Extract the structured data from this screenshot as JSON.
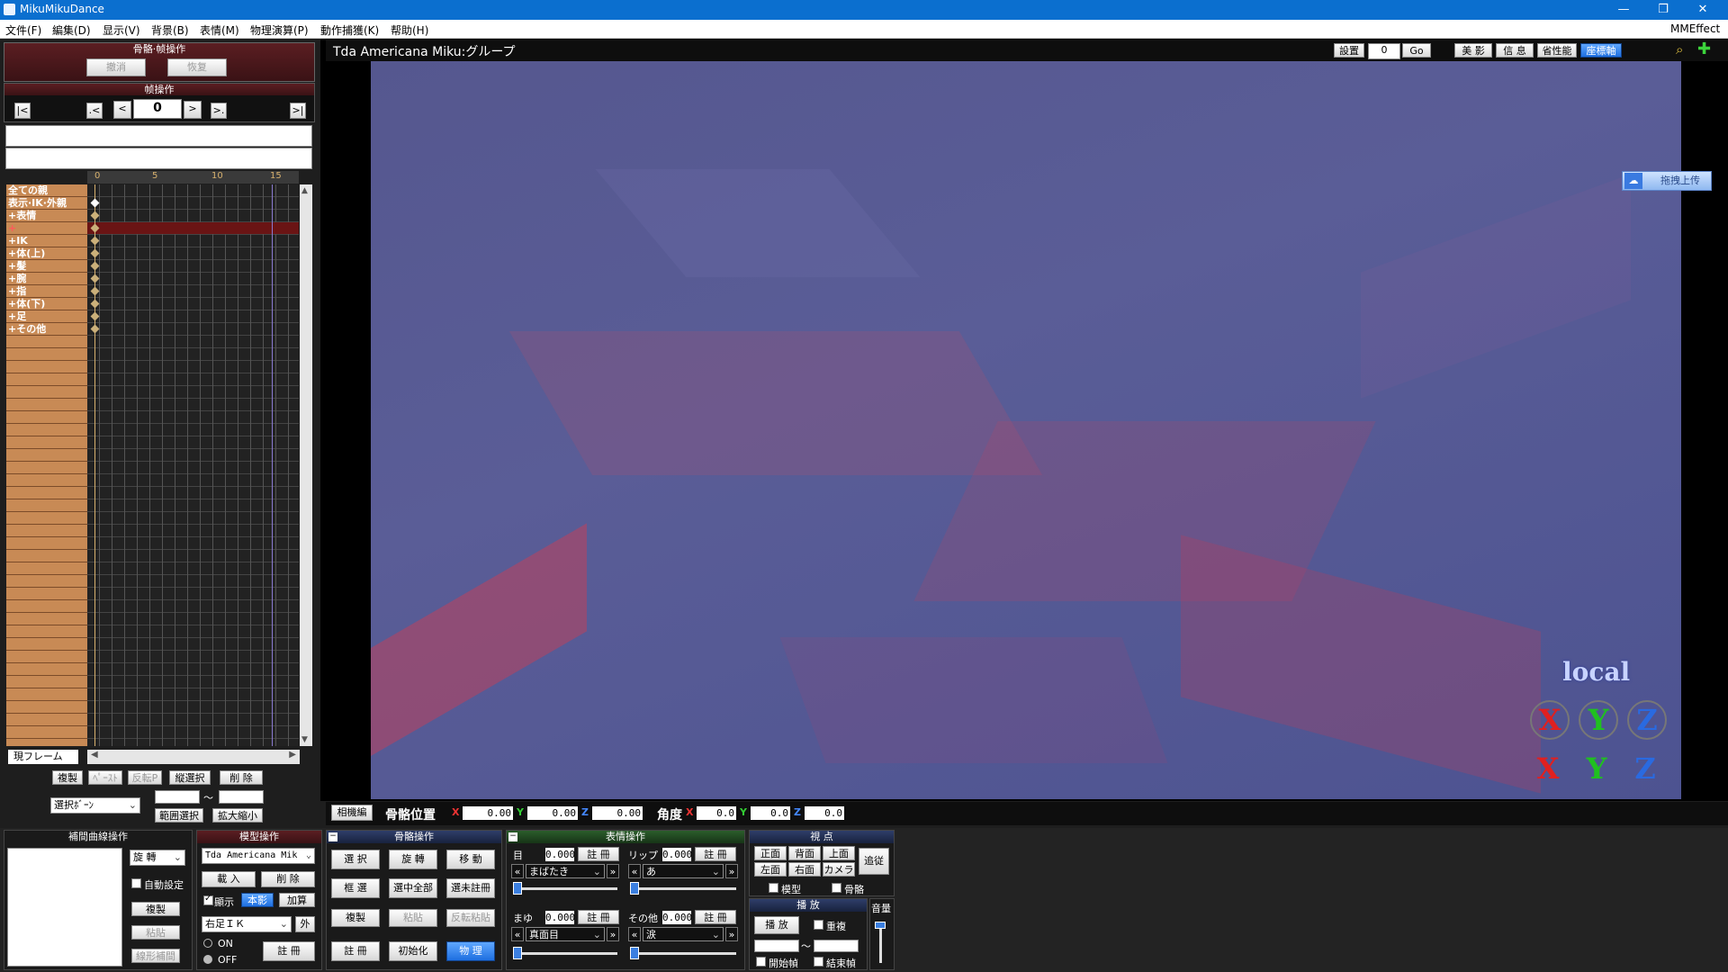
{
  "window": {
    "title": "MikuMikuDance",
    "controls": [
      "—",
      "❐",
      "✕"
    ]
  },
  "menu": {
    "items": [
      "文件(F)",
      "編集(D)",
      "显示(V)",
      "背景(B)",
      "表情(M)",
      "物理演算(P)",
      "動作捕獲(K)",
      "帮助(H)"
    ],
    "right": "MMEffect"
  },
  "left": {
    "header": "骨骼·帧操作",
    "undo": "撤消",
    "redo": "恢复",
    "frame_header": "帧操作",
    "frame_value": "0",
    "nav": [
      "|<",
      ".<",
      "<",
      ">",
      ">.",
      ">|"
    ],
    "ruler": [
      "0",
      "5",
      "10",
      "15"
    ],
    "tracks": [
      "全ての親",
      "表示·IK·外親",
      "+表情",
      "+",
      "+IK",
      "+体(上)",
      "+髪",
      "+腕",
      "+指",
      "+体(下)",
      "+足",
      "+その他"
    ],
    "current_frame_label": "現フレーム",
    "actions_row1": [
      "複製",
      "ﾍﾟｰｽﾄ",
      "反転P",
      "縦選択",
      "削 除"
    ],
    "select_bone": "選択ﾎﾞｰﾝ",
    "range_sep": "～",
    "range_select": "範囲選択",
    "scale": "拡大縮小"
  },
  "viewport": {
    "title": "Tda Americana Miku:グループ",
    "settings": "設置",
    "frame": "0",
    "go": "Go",
    "btns": [
      "美 影",
      "信 息",
      "省性能"
    ],
    "coord_btn": "座標軸",
    "upload": "拖拽上传",
    "local": "local",
    "axes": [
      "X",
      "Y",
      "Z"
    ]
  },
  "posrow": {
    "camera": "相機編",
    "pos_label": "骨骼位置",
    "pos": {
      "x": "0.00",
      "y": "0.00",
      "z": "0.00"
    },
    "ang_label": "角度",
    "ang": {
      "x": "0.0",
      "y": "0.0",
      "z": "0.0"
    }
  },
  "interp": {
    "header": "補間曲線操作",
    "rotate": "旋 轉",
    "auto": "自動設定",
    "copy": "複製",
    "paste": "粘貼",
    "linear": "線形補間"
  },
  "model": {
    "header": "模型操作",
    "model_name": "Tda Americana Mik",
    "load": "載 入",
    "delete": "削 除",
    "show": "顯示",
    "shadow": "本影",
    "add": "加算",
    "bone": "右足ＩＫ",
    "outer": "外",
    "on": "ON",
    "off": "OFF",
    "register": "註 冊"
  },
  "bone": {
    "header": "骨骼操作",
    "select": "選 択",
    "rotate": "旋 轉",
    "move": "移 動",
    "box": "框 選",
    "select_all": "選中全部",
    "unregistered": "選未註冊",
    "copy": "複製",
    "paste": "粘貼",
    "flip_paste": "反転粘貼",
    "register": "註 冊",
    "init": "初始化",
    "physics": "物 理"
  },
  "morph": {
    "header": "表情操作",
    "groups": [
      {
        "label": "目",
        "value": "0.000",
        "select": "まばたき"
      },
      {
        "label": "リップ",
        "value": "0.000",
        "select": "あ"
      },
      {
        "label": "まゆ",
        "value": "0.000",
        "select": "真面目"
      },
      {
        "label": "その他",
        "value": "0.000",
        "select": "涙"
      }
    ],
    "register": "註 冊"
  },
  "view": {
    "header": "視 点",
    "btns": [
      "正面",
      "背面",
      "上面",
      "左面",
      "右面",
      "カメラ"
    ],
    "follow": "追従",
    "model": "模型",
    "bone": "骨骼"
  },
  "play": {
    "header": "播 放",
    "play": "播 放",
    "repeat": "重複",
    "range_sep": "～",
    "start": "開始幀",
    "end": "結束幀"
  },
  "volume": {
    "label": "音量"
  }
}
